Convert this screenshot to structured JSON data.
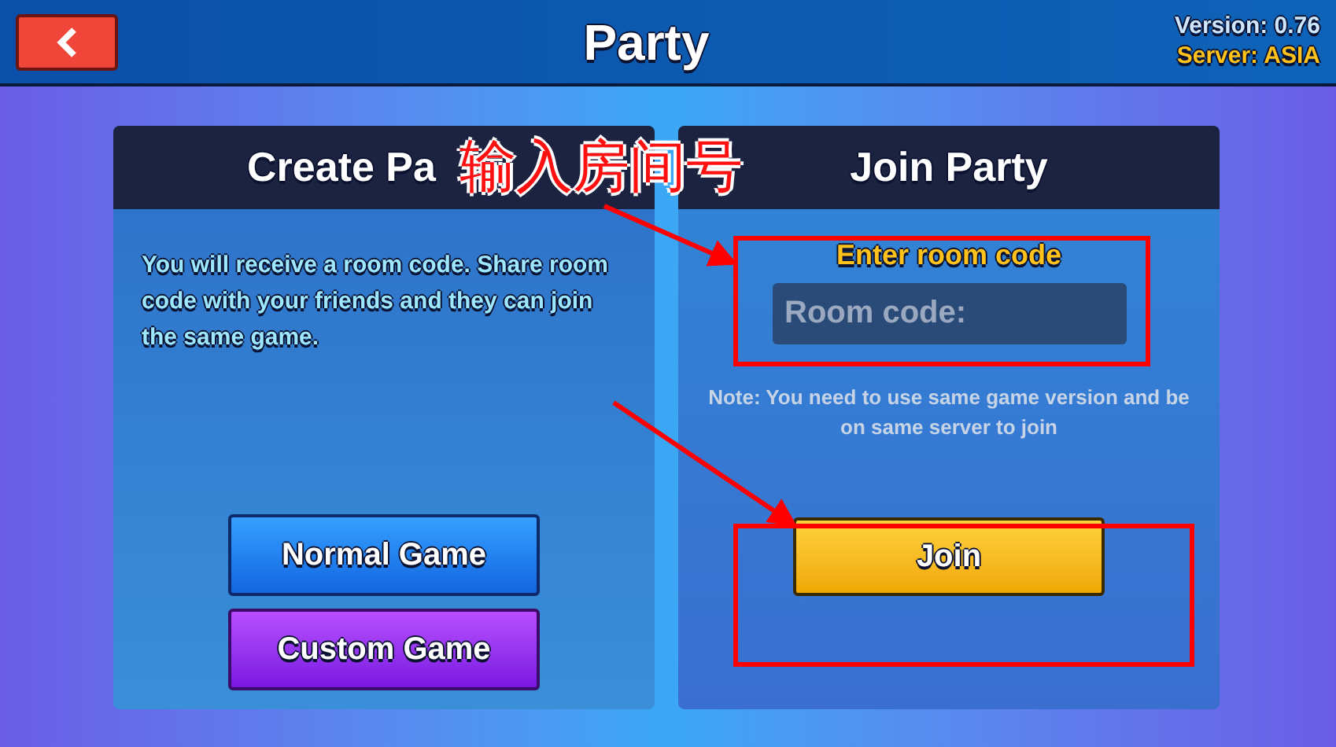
{
  "header": {
    "title": "Party",
    "version": "Version: 0.76",
    "server": "Server: ASIA"
  },
  "create_panel": {
    "title": "Create Pa",
    "description": "You will receive a room code. Share room code with your friends and they can join the same game.",
    "buttons": [
      {
        "label": "Normal Game",
        "kind": "normal"
      },
      {
        "label": "Custom Game",
        "kind": "custom"
      }
    ]
  },
  "join_panel": {
    "title": "Join Party",
    "field_label": "Enter room code",
    "placeholder": "Room code:",
    "note": "Note: You need to use same game version and be on same server to join",
    "button": "Join"
  },
  "annotation": {
    "label": "输入房间号"
  }
}
